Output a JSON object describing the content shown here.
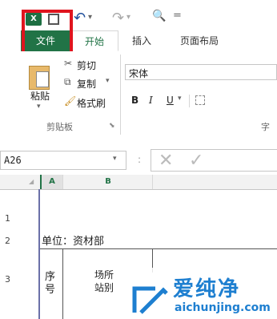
{
  "quick_access": {
    "undo_symbol": "↶",
    "redo_symbol": "↷",
    "dropdown_symbol": "▾",
    "print_preview_symbol": "🔍",
    "customize_symbol": "="
  },
  "tabs": [
    {
      "label": "文件"
    },
    {
      "label": "开始"
    },
    {
      "label": "插入"
    },
    {
      "label": "页面布局"
    }
  ],
  "ribbon": {
    "paste_label": "粘贴",
    "cut_label": "剪切",
    "copy_label": "复制",
    "format_painter_label": "格式刷",
    "clipboard_group_label": "剪贴板",
    "font_name": "宋体",
    "bold": "B",
    "italic": "I",
    "underline": "U",
    "font_group_label_partial": "字"
  },
  "formula_bar": {
    "name_box": "A26",
    "fx_colon": ":"
  },
  "sheet": {
    "col_headers": [
      "A",
      "B"
    ],
    "row_headers": [
      "1",
      "2",
      "3"
    ],
    "unit_text": "单位：资材部",
    "seq_col": [
      "序",
      "号"
    ],
    "site_col": [
      "场所",
      "站别"
    ]
  },
  "watermark": {
    "brand": "爱纯净",
    "url": "aichunjing.com"
  },
  "colors": {
    "excel_green": "#217346",
    "highlight_red": "#e0141e",
    "watermark_blue": "#1e7fd0"
  }
}
